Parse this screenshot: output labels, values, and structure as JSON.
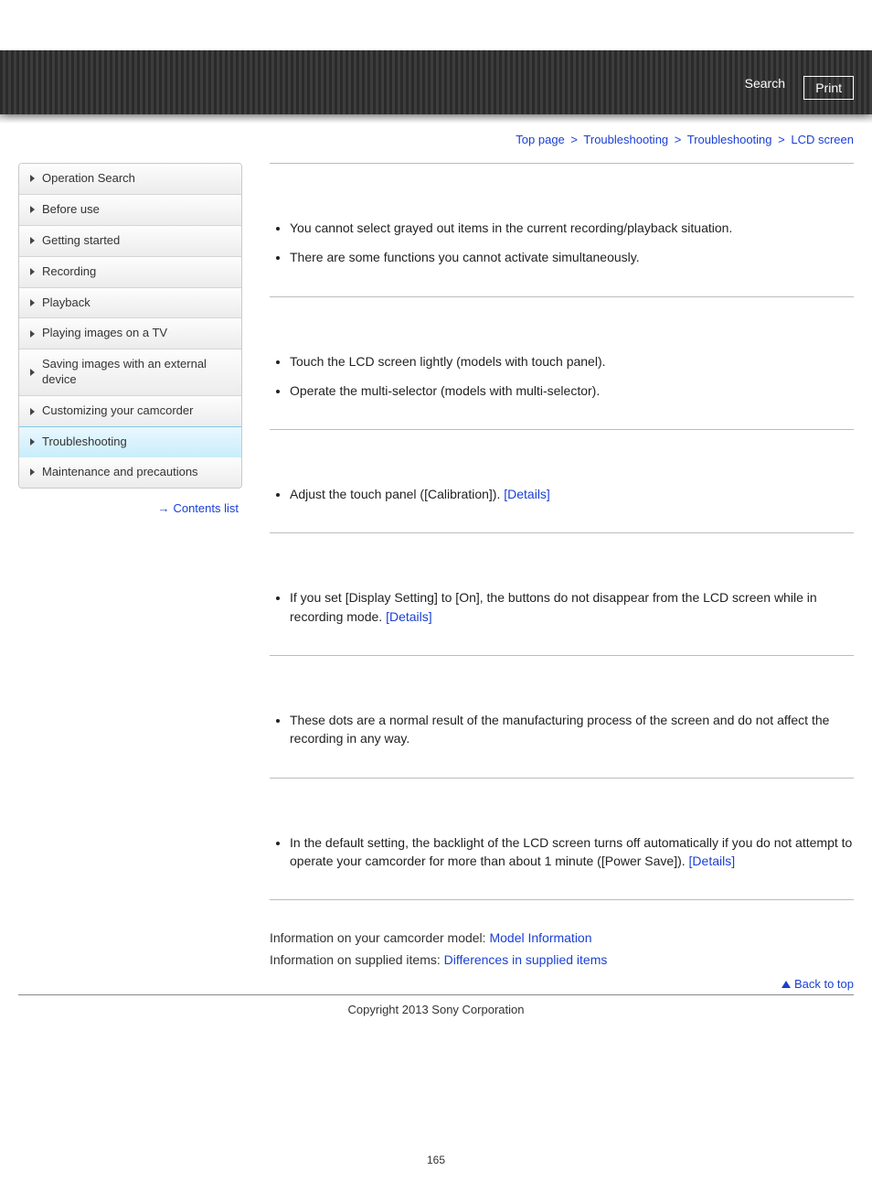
{
  "header": {
    "search_label": "Search",
    "print_label": "Print"
  },
  "breadcrumb": {
    "items": [
      "Top page",
      "Troubleshooting",
      "Troubleshooting",
      "LCD screen"
    ],
    "sep": ">"
  },
  "sidebar": {
    "items": [
      {
        "label": "Operation Search"
      },
      {
        "label": "Before use"
      },
      {
        "label": "Getting started"
      },
      {
        "label": "Recording"
      },
      {
        "label": "Playback"
      },
      {
        "label": "Playing images on a TV"
      },
      {
        "label": "Saving images with an external device"
      },
      {
        "label": "Customizing your camcorder"
      },
      {
        "label": "Troubleshooting",
        "active": true
      },
      {
        "label": "Maintenance and precautions"
      }
    ],
    "contents_link": "Contents list"
  },
  "sections": [
    {
      "items": [
        {
          "text": "You cannot select grayed out items in the current recording/playback situation."
        },
        {
          "text": "There are some functions you cannot activate simultaneously."
        }
      ]
    },
    {
      "items": [
        {
          "text": "Touch the LCD screen lightly (models with touch panel)."
        },
        {
          "text": "Operate the multi-selector (models with multi-selector)."
        }
      ]
    },
    {
      "items": [
        {
          "text": "Adjust the touch panel ([Calibration]). ",
          "link": "[Details]"
        }
      ]
    },
    {
      "items": [
        {
          "text": "If you set [Display Setting] to [On], the buttons do not disappear from the LCD screen while in recording mode. ",
          "link": "[Details]"
        }
      ]
    },
    {
      "items": [
        {
          "text": "These dots are a normal result of the manufacturing process of the screen and do not affect the recording in any way."
        }
      ]
    },
    {
      "items": [
        {
          "text": "In the default setting, the backlight of the LCD screen turns off automatically if you do not attempt to operate your camcorder for more than about 1 minute ([Power Save]). ",
          "link": "[Details]"
        }
      ]
    }
  ],
  "info": {
    "line1_label": "Information on your camcorder model: ",
    "line1_link": "Model Information",
    "line2_label": "Information on supplied items: ",
    "line2_link": "Differences in supplied items"
  },
  "back_to_top": "Back to top",
  "copyright": "Copyright 2013 Sony Corporation",
  "page_number": "165"
}
